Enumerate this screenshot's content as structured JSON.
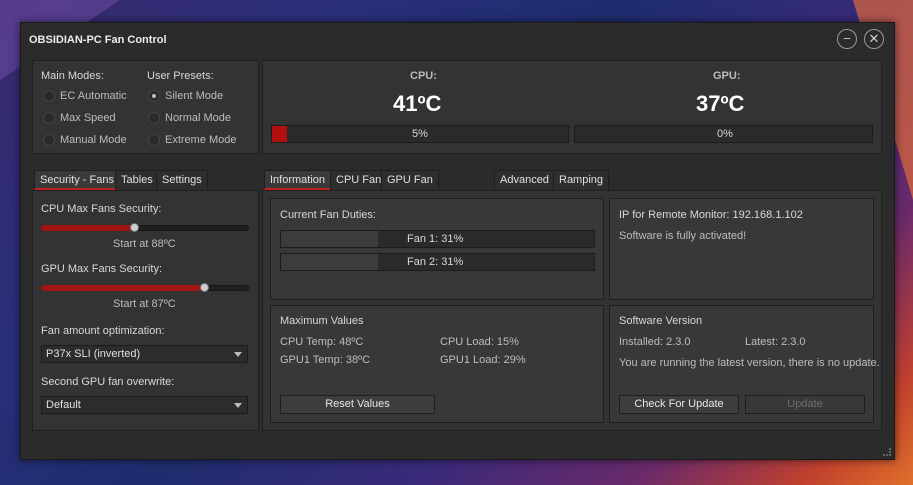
{
  "window": {
    "title": "OBSIDIAN-PC Fan Control"
  },
  "modes": {
    "main_label": "Main Modes:",
    "main_items": [
      "EC Automatic",
      "Max Speed",
      "Manual Mode"
    ],
    "preset_label": "User Presets:",
    "preset_items": [
      "Silent Mode",
      "Normal Mode",
      "Extreme Mode"
    ],
    "selected_preset": "Silent Mode"
  },
  "temps": {
    "cpu_label": "CPU:",
    "cpu_value": "41ºC",
    "cpu_bar_text": "5%",
    "cpu_level": 0.05,
    "gpu_label": "GPU:",
    "gpu_value": "37ºC",
    "gpu_bar_text": "0%",
    "gpu_level": 0.0,
    "accent": "#b01010"
  },
  "left_tabs": [
    "Security - Fans",
    "Tables",
    "Settings"
  ],
  "security": {
    "cpu_label": "CPU Max Fans Security:",
    "cpu_level": 0.45,
    "cpu_start": "Start at 88ºC",
    "gpu_label": "GPU Max Fans Security:",
    "gpu_level": 0.79,
    "gpu_start": "Start at 87ºC",
    "fan_opt_label": "Fan amount optimization:",
    "fan_opt_value": "P37x SLI (inverted)",
    "second_gpu_label": "Second GPU fan overwrite:",
    "second_gpu_value": "Default"
  },
  "right_tabs": [
    "Information",
    "CPU Fan",
    "GPU Fan",
    "Advanced",
    "Ramping"
  ],
  "info": {
    "duties_label": "Current Fan Duties:",
    "fan1": "Fan 1:  31%",
    "fan1_level": 0.31,
    "fan2": "Fan 2:  31%",
    "fan2_level": 0.31,
    "ip_text": "IP for Remote Monitor: 192.168.1.102",
    "activated": "Software is fully activated!",
    "max_label": "Maximum Values",
    "cpu_temp": "CPU Temp: 48ºC",
    "cpu_load": "CPU Load: 15%",
    "gpu_temp": "GPU1 Temp: 38ºC",
    "gpu_load": "GPU1 Load: 29%",
    "reset": "Reset Values",
    "version_label": "Software Version",
    "installed": "Installed: 2.3.0",
    "latest": "Latest: 2.3.0",
    "status": "You are running the latest version, there is no update.",
    "check": "Check For Update",
    "update": "Update"
  }
}
